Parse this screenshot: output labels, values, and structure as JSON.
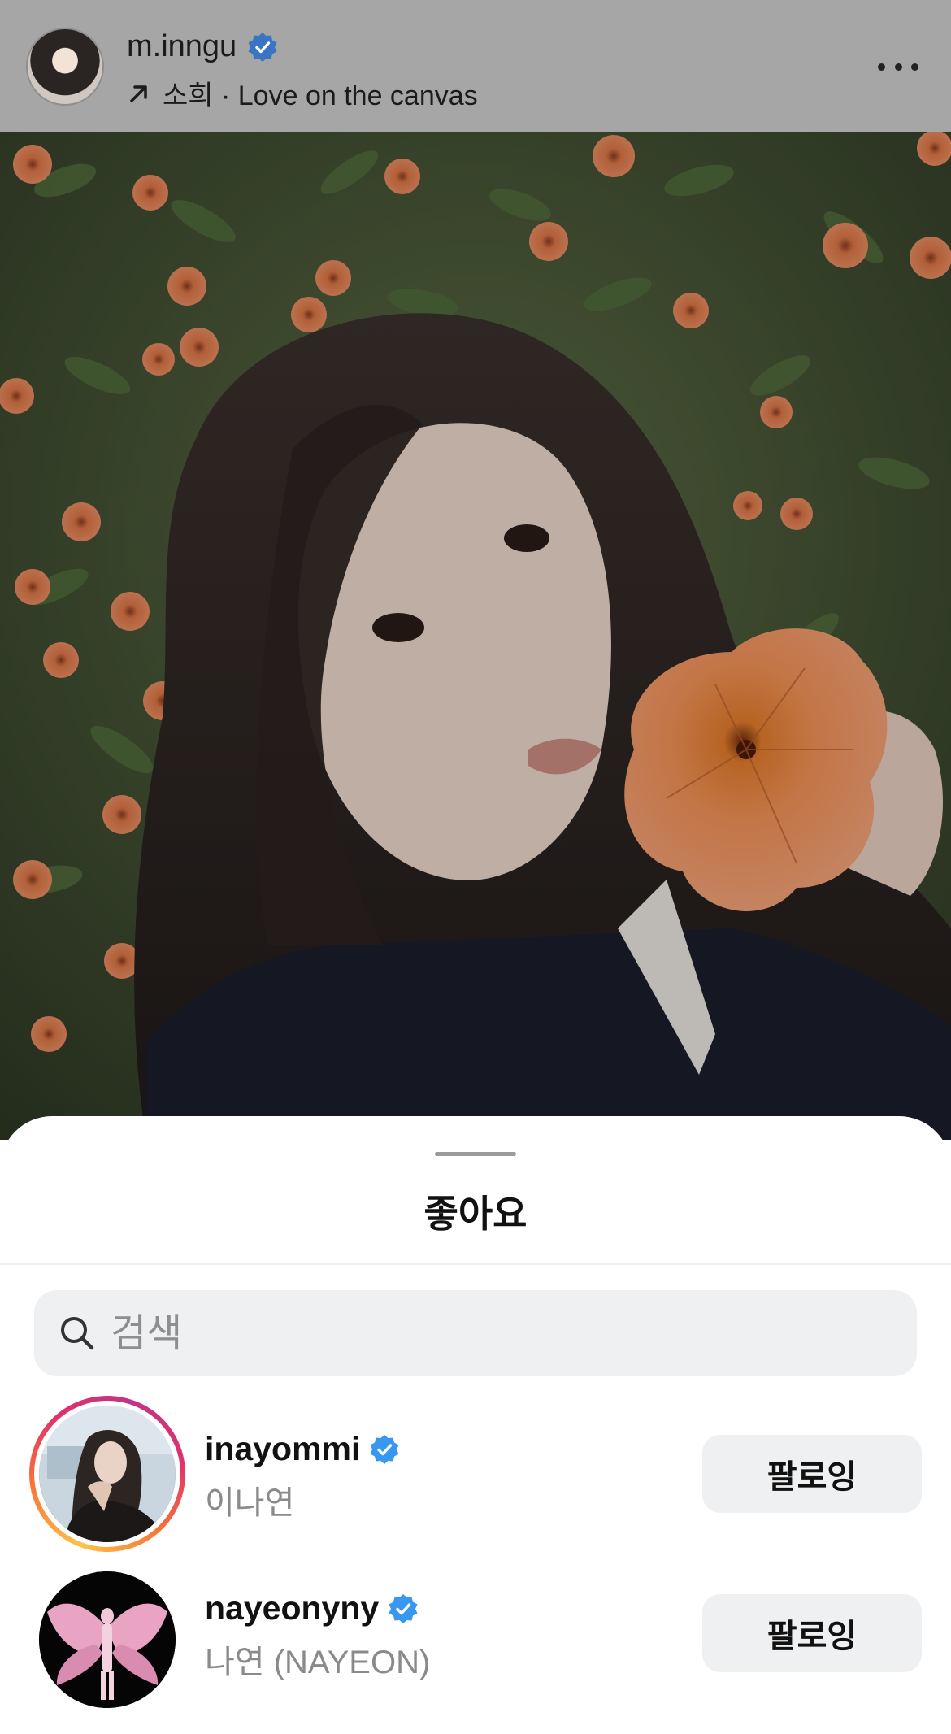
{
  "post_header": {
    "username": "m.inngu",
    "verified": true,
    "subline": "소희 · Love on the canvas",
    "more_icon": "more-horizontal-icon"
  },
  "likes_sheet": {
    "title": "좋아요",
    "search": {
      "placeholder": "검색",
      "value": ""
    },
    "items": [
      {
        "username": "inayommi",
        "verified": true,
        "full_name": "이나연",
        "button": "팔로잉",
        "story_ring": true
      },
      {
        "username": "nayeonyny",
        "verified": true,
        "full_name": "나연 (NAYEON)",
        "button": "팔로잉",
        "story_ring": false
      }
    ]
  },
  "colors": {
    "verified_blue": "#3897f0",
    "button_bg": "#eff0f2",
    "secondary_text": "#8a8a8a"
  }
}
